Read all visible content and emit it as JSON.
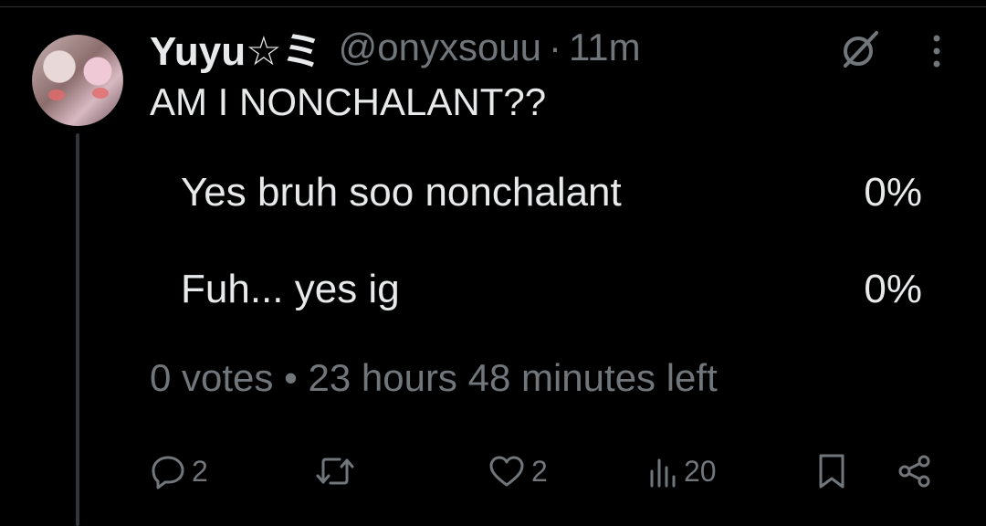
{
  "tweet": {
    "author": {
      "display_name": "Yuyu☆ミ",
      "handle": "@onyxsouu",
      "separator": "·",
      "time": "11m"
    },
    "text": "AM I NONCHALANT??",
    "poll": {
      "options": [
        {
          "label": "Yes bruh soo nonchalant",
          "percent": "0%"
        },
        {
          "label": "Fuh... yes ig",
          "percent": "0%"
        }
      ],
      "votes": "0 votes",
      "meta_separator": "•",
      "time_left": "23 hours 48 minutes left"
    },
    "actions": {
      "replies": "2",
      "likes": "2",
      "views": "20"
    }
  },
  "icons": {
    "grok": "grok-icon",
    "more": "more-icon",
    "reply": "reply-icon",
    "retweet": "retweet-icon",
    "like": "heart-icon",
    "views": "views-icon",
    "bookmark": "bookmark-icon",
    "share": "share-icon"
  },
  "colors": {
    "background": "#000000",
    "text": "#e7e9ea",
    "muted": "#71767b",
    "divider": "#2f3336"
  }
}
